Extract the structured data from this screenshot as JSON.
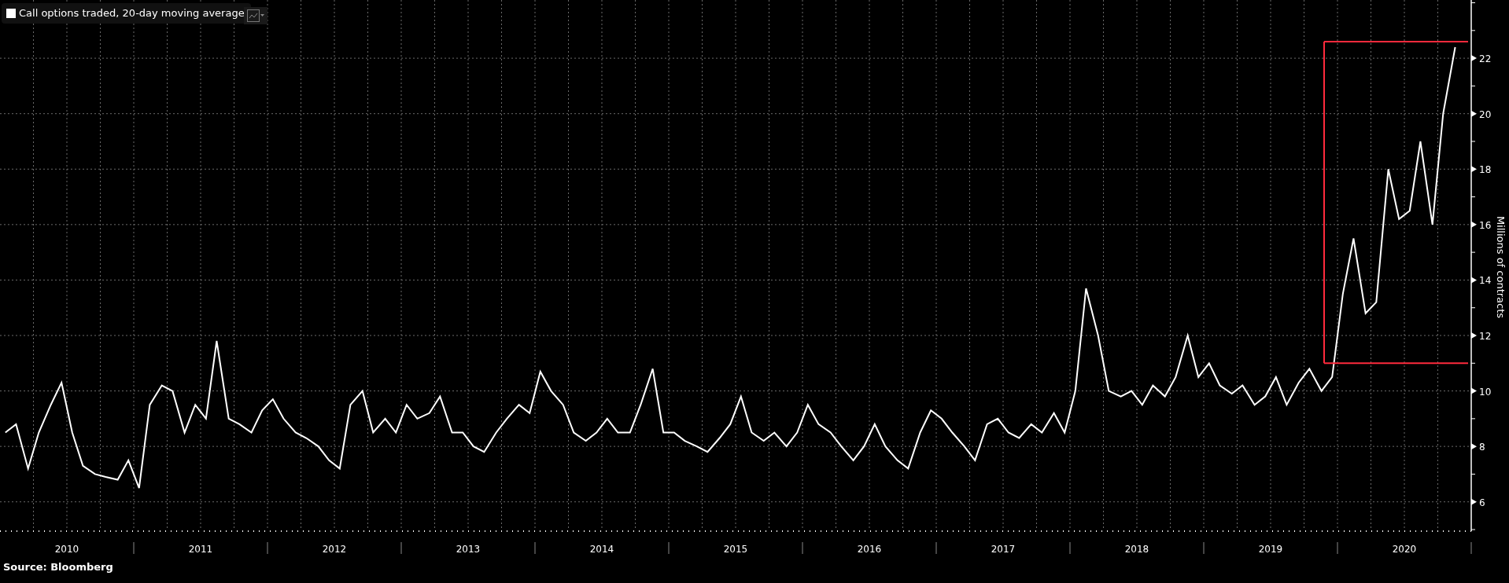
{
  "chart_data": {
    "type": "line",
    "title": "Call options traded, 20-day moving average",
    "ylabel": "Millions of contracts",
    "xlim": [
      2010,
      2021
    ],
    "ylim": [
      5,
      24.1
    ],
    "grid": true,
    "xticks": [
      {
        "value": 2010.5,
        "label": "2010"
      },
      {
        "value": 2011.5,
        "label": "2011"
      },
      {
        "value": 2012.5,
        "label": "2012"
      },
      {
        "value": 2013.5,
        "label": "2013"
      },
      {
        "value": 2014.5,
        "label": "2014"
      },
      {
        "value": 2015.5,
        "label": "2015"
      },
      {
        "value": 2016.5,
        "label": "2016"
      },
      {
        "value": 2017.5,
        "label": "2017"
      },
      {
        "value": 2018.5,
        "label": "2018"
      },
      {
        "value": 2019.5,
        "label": "2019"
      },
      {
        "value": 2020.5,
        "label": "2020"
      }
    ],
    "yticks": [
      6,
      8,
      10,
      12,
      14,
      16,
      18,
      20,
      22
    ],
    "x": [
      2010.04,
      2010.12,
      2010.21,
      2010.29,
      2010.38,
      2010.46,
      2010.54,
      2010.62,
      2010.71,
      2010.79,
      2010.88,
      2010.96,
      2011.04,
      2011.12,
      2011.21,
      2011.29,
      2011.38,
      2011.46,
      2011.54,
      2011.62,
      2011.71,
      2011.79,
      2011.88,
      2011.96,
      2012.04,
      2012.12,
      2012.21,
      2012.29,
      2012.38,
      2012.46,
      2012.54,
      2012.62,
      2012.71,
      2012.79,
      2012.88,
      2012.96,
      2013.04,
      2013.12,
      2013.21,
      2013.29,
      2013.38,
      2013.46,
      2013.54,
      2013.62,
      2013.71,
      2013.79,
      2013.88,
      2013.96,
      2014.04,
      2014.12,
      2014.21,
      2014.29,
      2014.38,
      2014.46,
      2014.54,
      2014.62,
      2014.71,
      2014.79,
      2014.88,
      2014.96,
      2015.04,
      2015.12,
      2015.21,
      2015.29,
      2015.38,
      2015.46,
      2015.54,
      2015.62,
      2015.71,
      2015.79,
      2015.88,
      2015.96,
      2016.04,
      2016.12,
      2016.21,
      2016.29,
      2016.38,
      2016.46,
      2016.54,
      2016.62,
      2016.71,
      2016.79,
      2016.88,
      2016.96,
      2017.04,
      2017.12,
      2017.21,
      2017.29,
      2017.38,
      2017.46,
      2017.54,
      2017.62,
      2017.71,
      2017.79,
      2017.88,
      2017.96,
      2018.04,
      2018.12,
      2018.21,
      2018.29,
      2018.38,
      2018.46,
      2018.54,
      2018.62,
      2018.71,
      2018.79,
      2018.88,
      2018.96,
      2019.04,
      2019.12,
      2019.21,
      2019.29,
      2019.38,
      2019.46,
      2019.54,
      2019.62,
      2019.71,
      2019.79,
      2019.88,
      2019.96,
      2020.04,
      2020.12,
      2020.21,
      2020.29,
      2020.38,
      2020.46,
      2020.54,
      2020.62,
      2020.71,
      2020.79,
      2020.88
    ],
    "series": [
      {
        "color": "#ffffff",
        "values": [
          8.5,
          8.8,
          7.2,
          8.5,
          9.5,
          10.3,
          8.5,
          7.3,
          7.0,
          6.9,
          6.8,
          7.5,
          6.5,
          9.5,
          10.2,
          10.0,
          8.5,
          9.5,
          9.0,
          11.8,
          9.0,
          8.8,
          8.5,
          9.3,
          9.7,
          9.0,
          8.5,
          8.3,
          8.0,
          7.5,
          7.2,
          9.5,
          10.0,
          8.5,
          9.0,
          8.5,
          9.5,
          9.0,
          9.2,
          9.8,
          8.5,
          8.5,
          8.0,
          7.8,
          8.5,
          9.0,
          9.5,
          9.2,
          10.7,
          10.0,
          9.5,
          8.5,
          8.2,
          8.5,
          9.0,
          8.5,
          8.5,
          9.5,
          10.8,
          8.5,
          8.5,
          8.2,
          8.0,
          7.8,
          8.3,
          8.8,
          9.8,
          8.5,
          8.2,
          8.5,
          8.0,
          8.5,
          9.5,
          8.8,
          8.5,
          8.0,
          7.5,
          8.0,
          8.8,
          8.0,
          7.5,
          7.2,
          8.5,
          9.3,
          9.0,
          8.5,
          8.0,
          7.5,
          8.8,
          9.0,
          8.5,
          8.3,
          8.8,
          8.5,
          9.2,
          8.5,
          10.0,
          13.7,
          12.0,
          10.0,
          9.8,
          10.0,
          9.5,
          10.2,
          9.8,
          10.5,
          12.0,
          10.5,
          11.0,
          10.2,
          9.9,
          10.2,
          9.5,
          9.8,
          10.5,
          9.5,
          10.3,
          10.8,
          10.0,
          10.5,
          13.5,
          15.5,
          12.8,
          13.2,
          18.0,
          16.2,
          16.5,
          19.0,
          16.0,
          20.0,
          22.4
        ]
      }
    ],
    "ref_lines": [
      {
        "axis": "x",
        "value": 2019.9,
        "color": "#ff2a3c"
      },
      {
        "axis": "y",
        "value": 22.6,
        "color": "#ff2a3c"
      },
      {
        "axis": "y",
        "value": 11,
        "color": "#ff2a3c"
      }
    ]
  },
  "source": "Source:  Bloomberg"
}
